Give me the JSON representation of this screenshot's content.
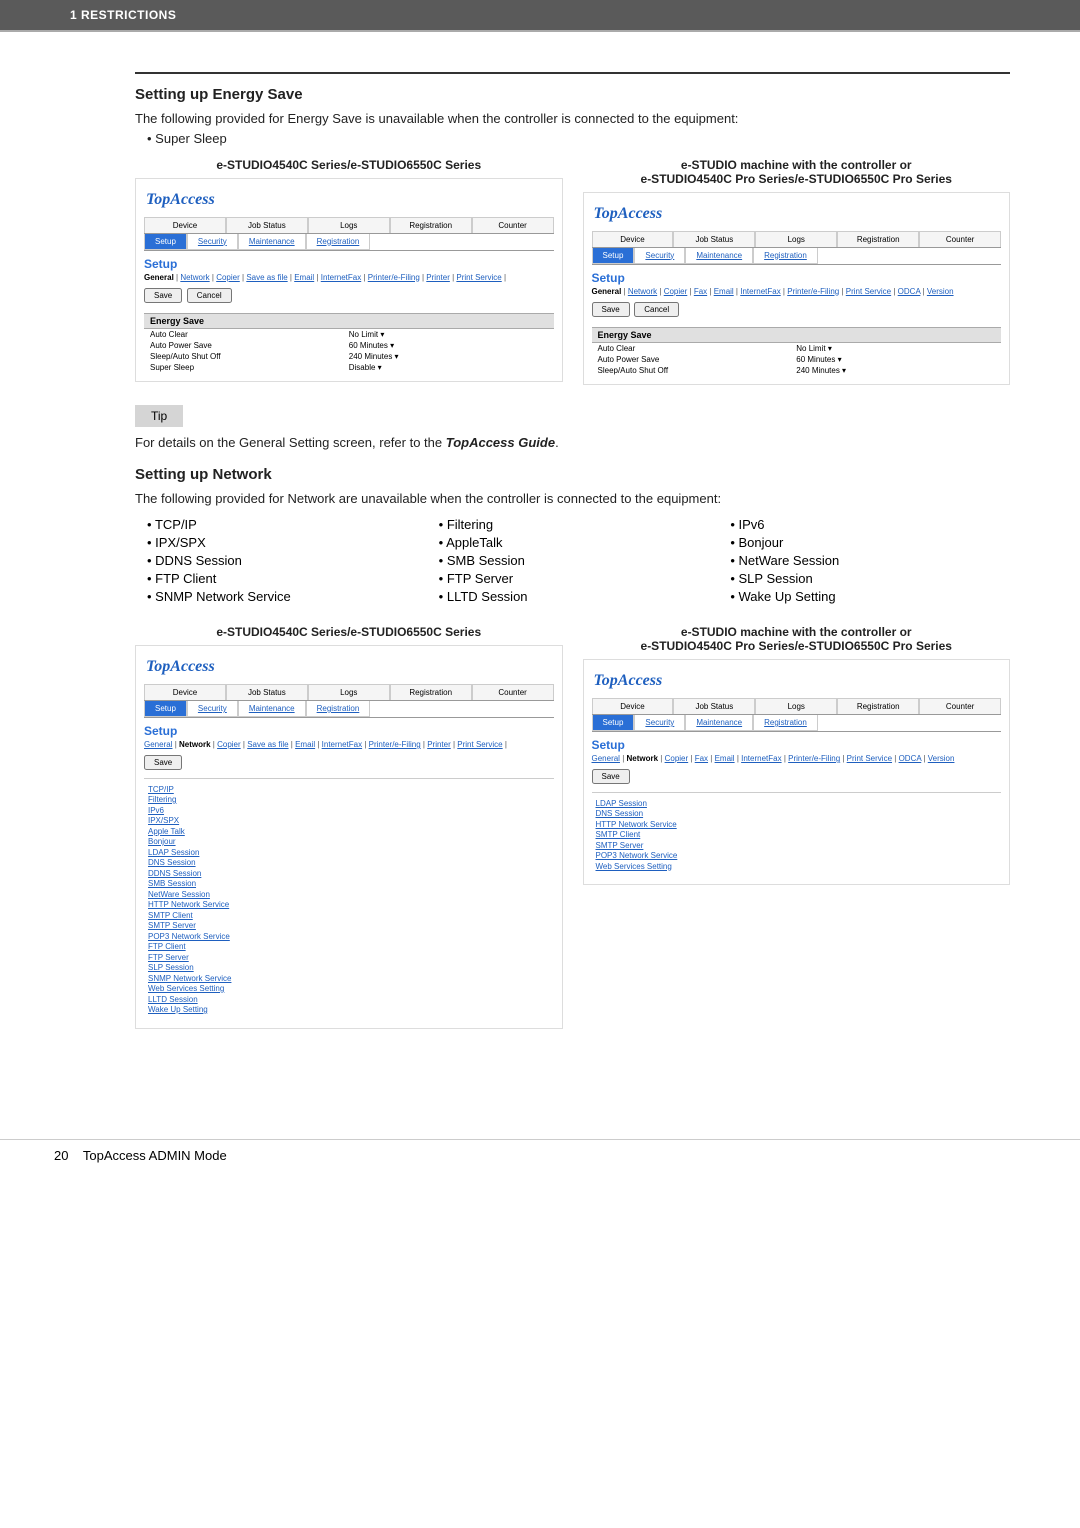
{
  "header": {
    "text": "1 RESTRICTIONS"
  },
  "section1": {
    "title": "Setting up Energy Save",
    "intro": "The following provided for Energy Save is unavailable when the controller is connected to the equipment:",
    "bullets": [
      "Super Sleep"
    ],
    "leftCaption": "e-STUDIO4540C Series/e-STUDIO6550C Series",
    "rightCaption": "e-STUDIO machine with the controller or\ne-STUDIO4540C Pro Series/e-STUDIO6550C Pro Series"
  },
  "topaccess": {
    "logo": "TopAccess",
    "tabs1": [
      "Device",
      "Job Status",
      "Logs",
      "Registration",
      "Counter"
    ],
    "tabs2": [
      "Setup",
      "Security",
      "Maintenance",
      "Registration"
    ],
    "setupTitle": "Setup",
    "saveLabel": "Save",
    "cancelLabel": "Cancel",
    "energySave": {
      "header": "Energy Save",
      "rows": [
        {
          "label": "Auto Clear",
          "value": "No Limit ▾"
        },
        {
          "label": "Auto Power Save",
          "value": "60 Minutes ▾"
        },
        {
          "label": "Sleep/Auto Shut Off",
          "value": "240 Minutes ▾"
        },
        {
          "label": "Super Sleep",
          "value": "Disable ▾"
        }
      ]
    }
  },
  "subtabs": {
    "left1": "General | Network | Copier | Save as file | Email | InternetFax | Printer/e-Filing | Printer | Print Service |",
    "right1": "General | Network | Copier | Fax | Email | InternetFax | Printer/e-Filing | Print Service | ODCA | Version",
    "left2": "General | Network | Copier | Save as file | Email | InternetFax | Printer/e-Filing | Printer | Print Service |",
    "right2": "General | Network | Copier | Fax | Email | InternetFax | Printer/e-Filing | Print Service | ODCA | Version"
  },
  "tip": {
    "label": "Tip",
    "text": "For details on the General Setting screen, refer to the ",
    "em": "TopAccess Guide",
    "suffix": "."
  },
  "section2": {
    "title": "Setting up Network",
    "intro": "The following provided for Network are unavailable when the controller is connected to the equipment:",
    "col1": [
      "TCP/IP",
      "IPX/SPX",
      "DDNS Session",
      "FTP Client",
      "SNMP Network Service"
    ],
    "col2": [
      "Filtering",
      "AppleTalk",
      "SMB Session",
      "FTP Server",
      "LLTD Session"
    ],
    "col3": [
      "IPv6",
      "Bonjour",
      "NetWare Session",
      "SLP Session",
      "Wake Up Setting"
    ],
    "leftCaption": "e-STUDIO4540C Series/e-STUDIO6550C Series",
    "rightCaption": "e-STUDIO machine with the controller or\ne-STUDIO4540C Pro Series/e-STUDIO6550C Pro Series"
  },
  "leftLinks": [
    "TCP/IP",
    "Filtering",
    "IPv6",
    "IPX/SPX",
    "Apple Talk",
    "Bonjour",
    "LDAP Session",
    "DNS Session",
    "DDNS Session",
    "SMB Session",
    "NetWare Session",
    "HTTP Network Service",
    "SMTP Client",
    "SMTP Server",
    "POP3 Network Service",
    "FTP Client",
    "FTP Server",
    "SLP Session",
    "SNMP Network Service",
    "Web Services Setting",
    "LLTD Session",
    "Wake Up Setting"
  ],
  "rightLinks": [
    "LDAP Session",
    "DNS Session",
    "HTTP Network Service",
    "SMTP Client",
    "SMTP Server",
    "POP3 Network Service",
    "Web Services Setting"
  ],
  "footer": {
    "page": "20",
    "title": "TopAccess ADMIN Mode"
  }
}
